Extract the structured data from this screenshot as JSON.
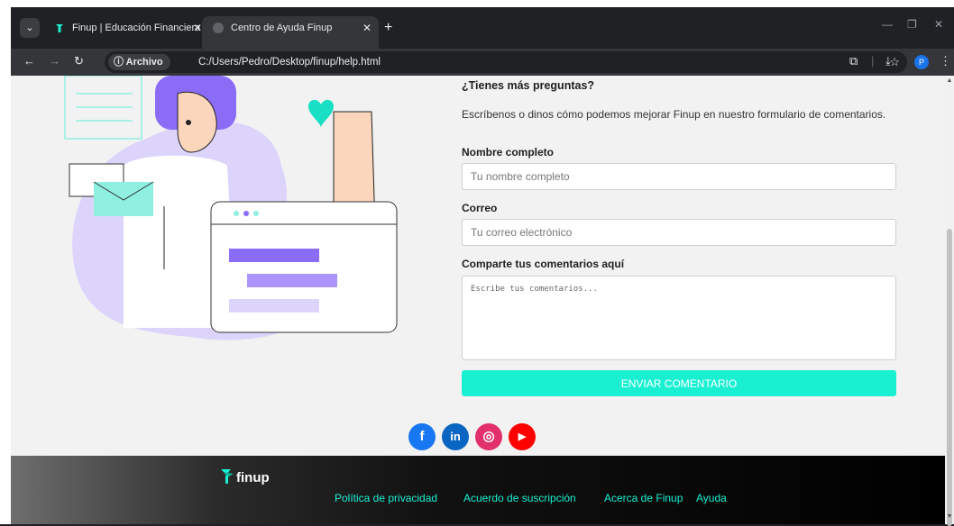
{
  "browser": {
    "tabs": [
      {
        "title": "Finup | Educación Financiera",
        "active": false
      },
      {
        "title": "Centro de Ayuda Finup",
        "active": true
      }
    ],
    "new_tab": "+",
    "close_symbol": "✕",
    "security_chip": "ⓘ Archivo",
    "url": "C:/Users/Pedro/Desktop/finup/help.html",
    "profile_initial": "P"
  },
  "form": {
    "heading": "¿Tienes más preguntas?",
    "subheading": "Escríbenos o dinos cómo podemos mejorar Finup en nuestro formulario de comentarios.",
    "name_label": "Nombre completo",
    "name_placeholder": "Tu nombre completo",
    "email_label": "Correo",
    "email_placeholder": "Tu correo electrónico",
    "comments_label": "Comparte tus comentarios aquí",
    "comments_placeholder": "Escribe tus comentarios...",
    "submit_label": "Enviar comentario"
  },
  "socials": [
    {
      "name": "facebook",
      "glyph": "f",
      "color": "#1877f2"
    },
    {
      "name": "linkedin",
      "glyph": "in",
      "color": "#0a66c2"
    },
    {
      "name": "instagram",
      "glyph": "◎",
      "color": "#e1306c"
    },
    {
      "name": "youtube",
      "glyph": "▶",
      "color": "#ff0000"
    }
  ],
  "footer": {
    "logo_text": "finup",
    "links": [
      "Política de privacidad",
      "Acuerdo de suscripción",
      "Acerca de Finup",
      "Ayuda"
    ]
  },
  "colors": {
    "accent": "#19f0d2",
    "purple": "#8a6cf7"
  }
}
